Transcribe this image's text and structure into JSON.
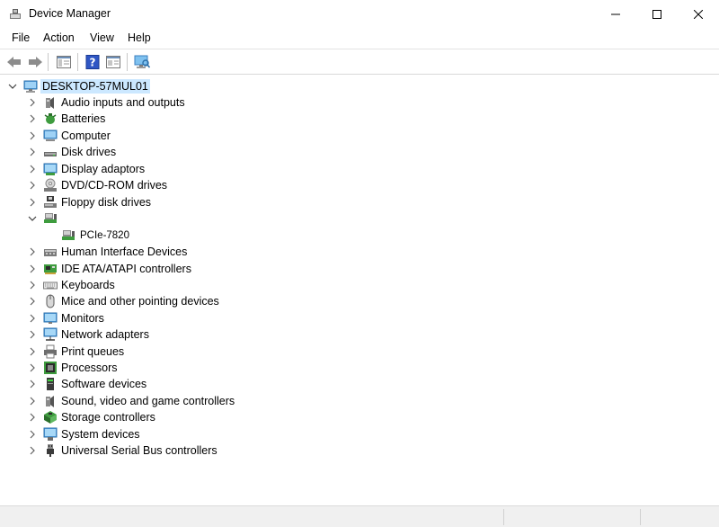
{
  "window": {
    "title": "Device Manager"
  },
  "menu": [
    "File",
    "Action",
    "View",
    "Help"
  ],
  "toolbar": {
    "buttons": [
      "back-icon",
      "forward-icon",
      "show-hide-console-tree-icon",
      "help-icon",
      "properties-icon",
      "scan-hardware-icon"
    ]
  },
  "tree": {
    "root": {
      "label": "DESKTOP-57MUL01",
      "expanded": true
    },
    "categories": [
      {
        "label": "Audio inputs and outputs",
        "icon": "speaker-icon",
        "expanded": false
      },
      {
        "label": "Batteries",
        "icon": "battery-icon",
        "expanded": false
      },
      {
        "label": "Computer",
        "icon": "computer-icon",
        "expanded": false
      },
      {
        "label": "Disk drives",
        "icon": "disk-drive-icon",
        "expanded": false
      },
      {
        "label": "Display adaptors",
        "icon": "display-adapter-icon",
        "expanded": false
      },
      {
        "label": "DVD/CD-ROM drives",
        "icon": "dvd-drive-icon",
        "expanded": false
      },
      {
        "label": "Floppy disk drives",
        "icon": "floppy-icon",
        "expanded": false
      },
      {
        "label": "",
        "icon": "pci-card-icon",
        "expanded": true,
        "children": [
          {
            "label": "PCIe-7820",
            "icon": "pci-card-icon"
          }
        ]
      },
      {
        "label": "Human Interface Devices",
        "icon": "hid-icon",
        "expanded": false
      },
      {
        "label": "IDE ATA/ATAPI controllers",
        "icon": "ide-controller-icon",
        "expanded": false
      },
      {
        "label": "Keyboards",
        "icon": "keyboard-icon",
        "expanded": false
      },
      {
        "label": "Mice and other pointing devices",
        "icon": "mouse-icon",
        "expanded": false
      },
      {
        "label": "Monitors",
        "icon": "monitor-icon",
        "expanded": false
      },
      {
        "label": "Network adapters",
        "icon": "network-icon",
        "expanded": false
      },
      {
        "label": "Print queues",
        "icon": "printer-icon",
        "expanded": false
      },
      {
        "label": "Processors",
        "icon": "processor-icon",
        "expanded": false
      },
      {
        "label": "Software devices",
        "icon": "software-device-icon",
        "expanded": false
      },
      {
        "label": "Sound, video and game controllers",
        "icon": "sound-icon",
        "expanded": false
      },
      {
        "label": "Storage controllers",
        "icon": "storage-controller-icon",
        "expanded": false
      },
      {
        "label": "System devices",
        "icon": "system-devices-icon",
        "expanded": false
      },
      {
        "label": "Universal Serial Bus controllers",
        "icon": "usb-icon",
        "expanded": false
      }
    ]
  },
  "colors": {
    "selection": "#cce8ff",
    "accent": "#1e78d7"
  }
}
